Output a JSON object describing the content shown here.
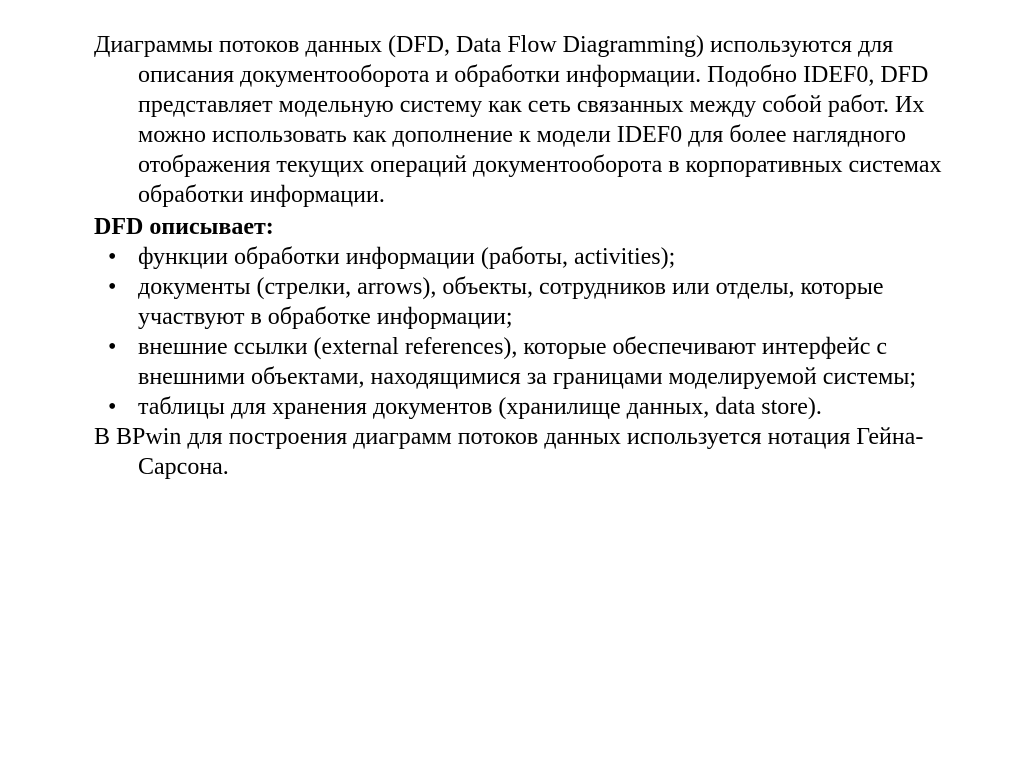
{
  "intro": "Диаграммы потоков данных (DFD, Data Flow Diagramming) используются для описания документооборота и обработки информации. Подобно IDEF0, DFD представляет модельную систему как сеть связанных между собой работ. Их можно использовать как дополнение к модели IDEF0 для более наглядного отображения текущих операций документооборота в корпоративных системах обработки информации.",
  "heading": "DFD описывает:",
  "bullets": [
    "функции обработки информации (работы, activities);",
    "документы (стрелки, arrows), объекты, сотрудников или отделы, которые участвуют в обработке информации;",
    "внешние ссылки (external references), которые обеспечивают интерфейс с внешними объектами, находящимися за границами моделируемой системы;",
    "таблицы для хранения документов (хранилище данных, data store)."
  ],
  "closing": "В BPwin для построения диаграмм потоков данных используется нотация Гейна-Сарсона."
}
